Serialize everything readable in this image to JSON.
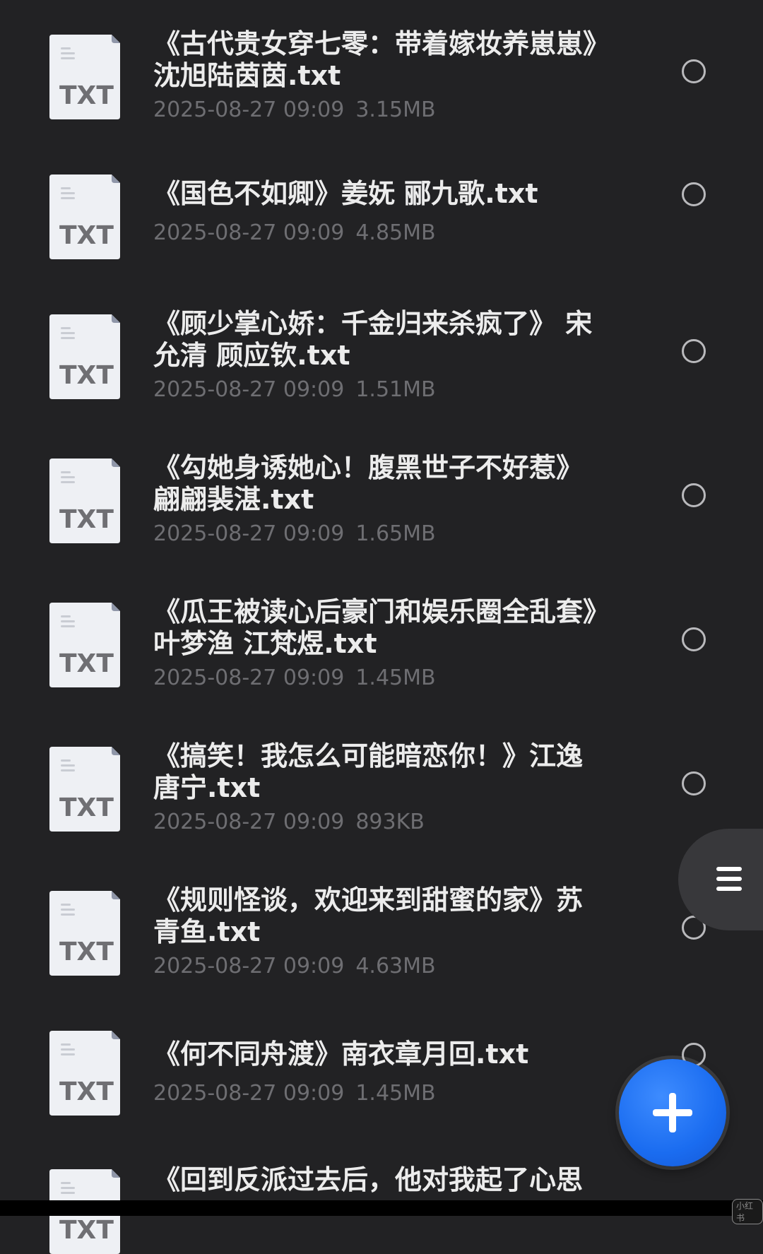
{
  "files": [
    {
      "title": "《古代贵女穿七零：带着嫁妆养崽崽》沈旭陆茵茵.txt",
      "date": "2025-08-27 09:09",
      "size": "3.15MB",
      "type": "TXT"
    },
    {
      "title": "《国色不如卿》姜妩 郦九歌.txt",
      "date": "2025-08-27 09:09",
      "size": "4.85MB",
      "type": "TXT"
    },
    {
      "title": "《顾少掌心娇：千金归来杀疯了》 宋允清 顾应钦.txt",
      "date": "2025-08-27 09:09",
      "size": "1.51MB",
      "type": "TXT"
    },
    {
      "title": "《勾她身诱她心！腹黑世子不好惹》翩翩裴湛.txt",
      "date": "2025-08-27 09:09",
      "size": "1.65MB",
      "type": "TXT"
    },
    {
      "title": "《瓜王被读心后豪门和娱乐圈全乱套》叶梦渔 江梵煜.txt",
      "date": "2025-08-27 09:09",
      "size": "1.45MB",
      "type": "TXT"
    },
    {
      "title": "《搞笑！我怎么可能暗恋你！》江逸唐宁.txt",
      "date": "2025-08-27 09:09",
      "size": "893KB",
      "type": "TXT"
    },
    {
      "title": "《规则怪谈，欢迎来到甜蜜的家》苏青鱼.txt",
      "date": "2025-08-27 09:09",
      "size": "4.63MB",
      "type": "TXT"
    },
    {
      "title": "《何不同舟渡》南衣章月回.txt",
      "date": "2025-08-27 09:09",
      "size": "1.45MB",
      "type": "TXT"
    },
    {
      "title": "《回到反派过去后，他对我起了心思",
      "date": "",
      "size": "",
      "type": "TXT"
    }
  ],
  "icons": {
    "file": "txt-file-icon",
    "select": "radio-circle-icon",
    "side_menu": "menu-lines-icon",
    "fab": "plus-icon"
  },
  "colors": {
    "background": "#222224",
    "title_text": "#ececec",
    "meta_text": "#6e6e72",
    "fab": "#1a6cf0",
    "file_icon": "#eef0f4"
  },
  "watermark": "小红书"
}
